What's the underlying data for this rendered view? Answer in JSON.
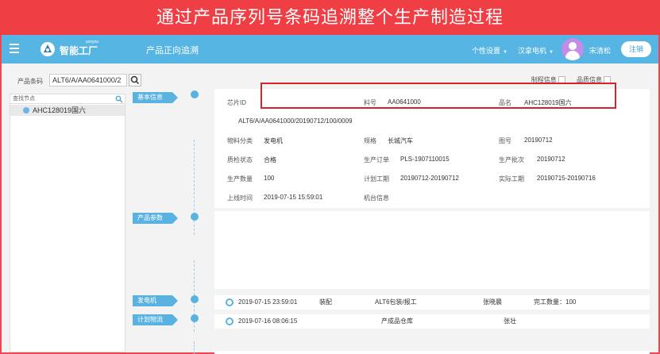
{
  "banner": {
    "title": "通过产品序列号条码追溯整个生产制造过程"
  },
  "nav": {
    "brand": "智能工厂",
    "brand_sub": "yonyou",
    "title": "产品正向追溯",
    "settings": "个性设置",
    "plant": "汉拿电机",
    "user": "宋清松",
    "logout": "注销"
  },
  "search": {
    "label": "产品条码",
    "value": "ALT6/A/AA0641000/2"
  },
  "tree": {
    "search_placeholder": "查找节点",
    "node": "AHC128019国六"
  },
  "tabs": {
    "process": "制程信息",
    "quality": "品质信息"
  },
  "sections": {
    "basic": "基本信息",
    "params": "产品参数",
    "generator": "发电机",
    "logistics": "计划物流"
  },
  "basic_info": {
    "chip_id_label": "芯片ID",
    "chip_id": "ALT6/A/AA0641000/20190712/100/0009",
    "material_no_label": "料号",
    "material_no": "AA0641000",
    "product_name_label": "品名",
    "product_name": "AHC128019国六",
    "material_class_label": "物料分类",
    "material_class": "发电机",
    "spec_label": "规格",
    "spec": "长城汽车",
    "drawing_no_label": "图号",
    "drawing_no": "20190712",
    "qc_status_label": "质检状态",
    "qc_status": "合格",
    "prod_order_label": "生产订单",
    "prod_order": "PLS-1907110015",
    "prod_batch_label": "生产批次",
    "prod_batch": "20190712",
    "prod_qty_label": "生产数量",
    "prod_qty": "100",
    "plan_period_label": "计划工期",
    "plan_period": "20190712-20190712",
    "actual_period_label": "实际工期",
    "actual_period": "20190715-20190716",
    "online_time_label": "上线时间",
    "online_time": "2019-07-15 15:59:01",
    "machine_info_label": "机台信息",
    "machine_info": ""
  },
  "generator_row": {
    "time": "2019-07-15 23:59:01",
    "op": "装配",
    "step": "ALT6包装/报工",
    "person": "张晓晨",
    "qty": "完工数量：100"
  },
  "logistics_row": {
    "time": "2019-07-16 08:06:15",
    "location": "产成品仓库",
    "person": "张壮"
  }
}
